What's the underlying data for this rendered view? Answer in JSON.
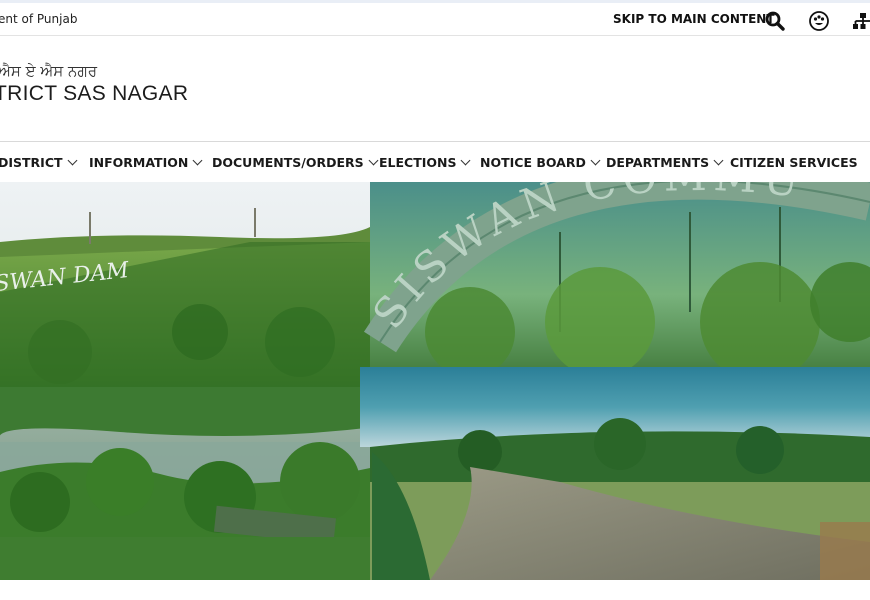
{
  "topbar": {
    "gov_text": "ent of Punjab",
    "skip_link": "SKIP TO MAIN CONTENT"
  },
  "header": {
    "punjabi_name": "ਐਸ ਏ ਐਸ ਨਗਰ",
    "district_name": "TRICT SAS NAGAR"
  },
  "nav": {
    "items": [
      {
        "label": "DISTRICT",
        "has_dropdown": true
      },
      {
        "label": "INFORMATION",
        "has_dropdown": true
      },
      {
        "label": "DOCUMENTS/ORDERS",
        "has_dropdown": true
      },
      {
        "label": "ELECTIONS",
        "has_dropdown": true
      },
      {
        "label": "NOTICE BOARD",
        "has_dropdown": true
      },
      {
        "label": "DEPARTMENTS",
        "has_dropdown": true
      },
      {
        "label": "CITIZEN SERVICES",
        "has_dropdown": false
      }
    ]
  },
  "banner": {
    "left_sign": "SWAN DAM",
    "right_sign": "SISWAN COMMU"
  },
  "colors": {
    "forest_green": "#3f7d2e",
    "sky": "#dfe8ee",
    "teal_band": "#2f7f95",
    "stone": "#8d8d7d"
  },
  "icons": [
    "search-icon",
    "sign-language-icon",
    "sitemap-icon",
    "chevron-down-icon"
  ]
}
